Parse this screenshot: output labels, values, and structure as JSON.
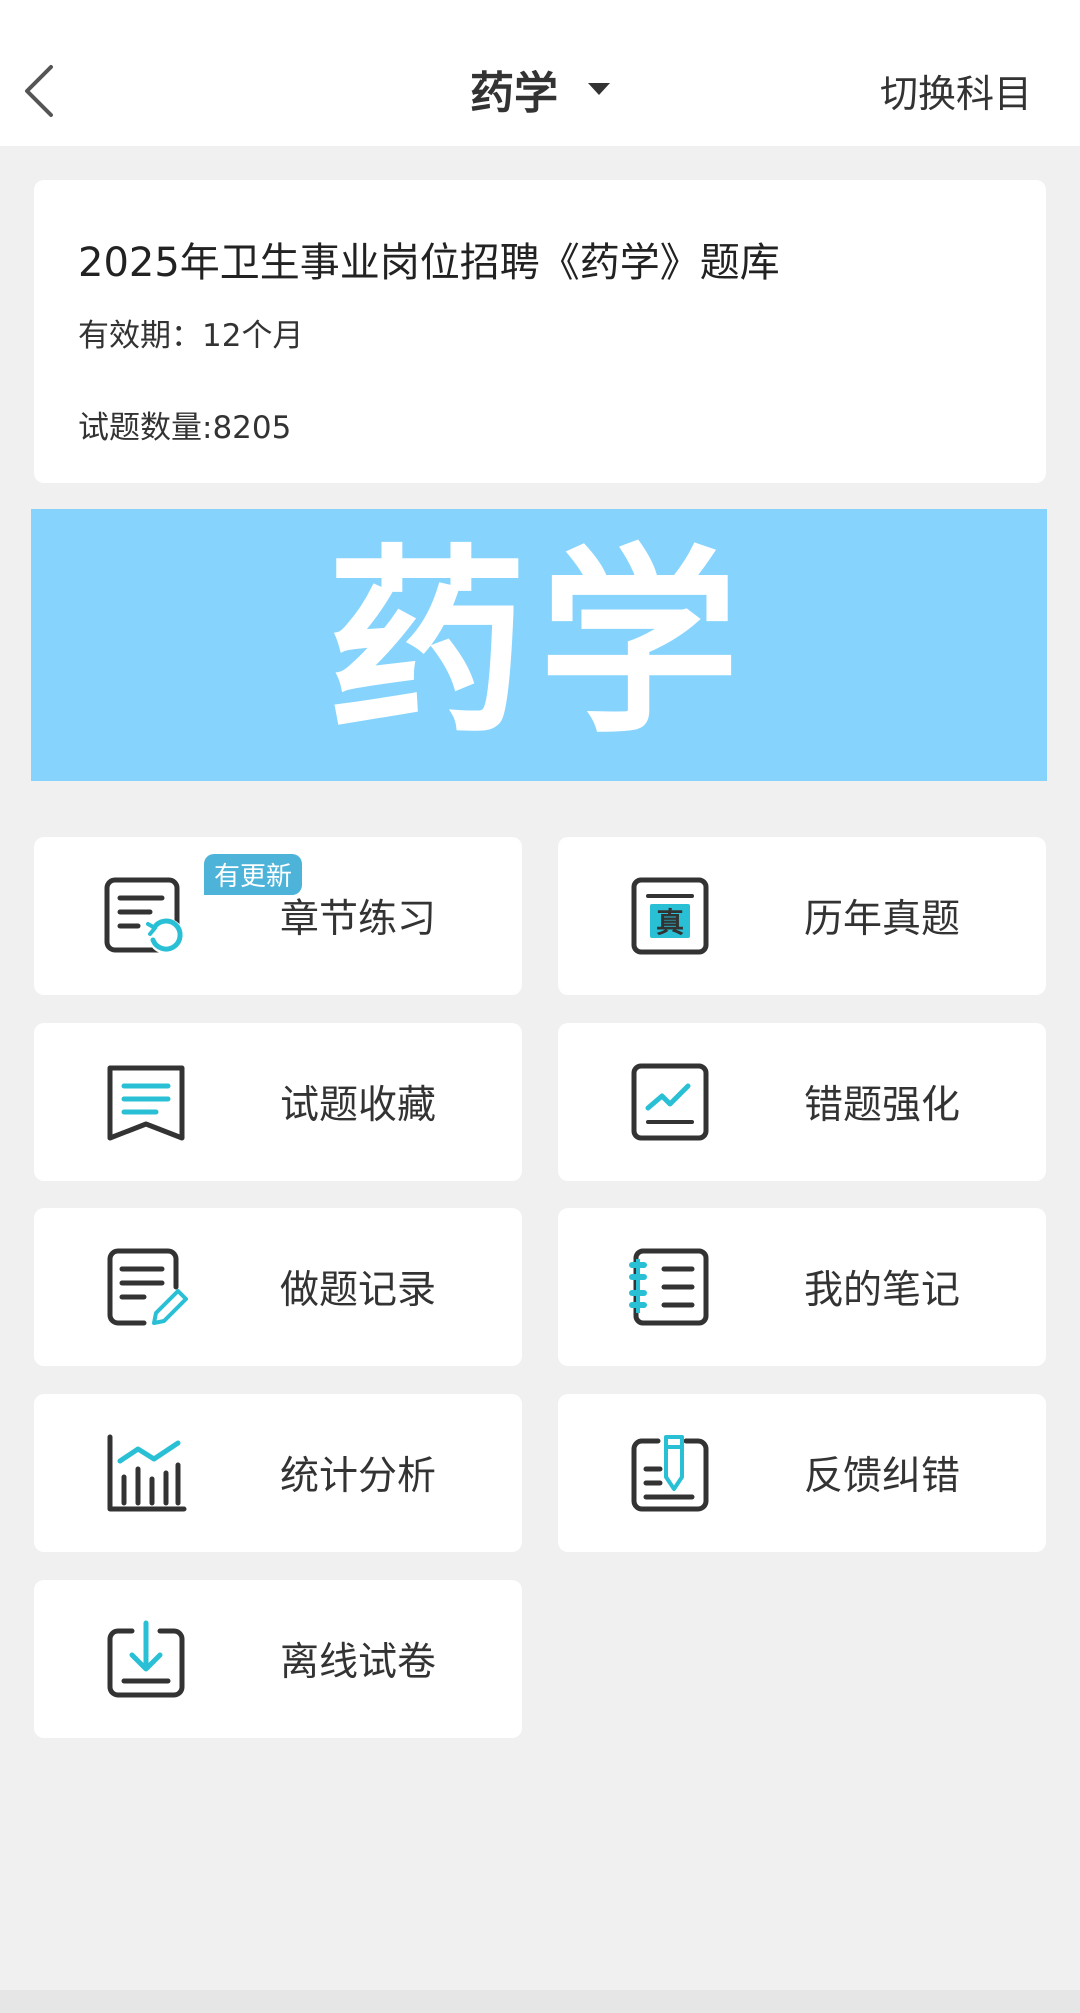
{
  "header": {
    "title": "药学",
    "switch_label": "切换科目"
  },
  "info": {
    "title": "2025年卫生事业岗位招聘《药学》题库",
    "validity": "有效期：12个月",
    "question_count": "试题数量:8205"
  },
  "banner": {
    "text": "药学"
  },
  "menu": [
    {
      "label": "章节练习",
      "icon": "chapter-refresh-icon",
      "badge": "有更新"
    },
    {
      "label": "历年真题",
      "icon": "real-exam-icon"
    },
    {
      "label": "试题收藏",
      "icon": "bookmark-icon"
    },
    {
      "label": "错题强化",
      "icon": "trend-chart-icon"
    },
    {
      "label": "做题记录",
      "icon": "edit-document-icon"
    },
    {
      "label": "我的笔记",
      "icon": "notebook-icon"
    },
    {
      "label": "统计分析",
      "icon": "bar-chart-icon"
    },
    {
      "label": "反馈纠错",
      "icon": "feedback-pen-icon"
    },
    {
      "label": "离线试卷",
      "icon": "download-icon"
    }
  ],
  "colors": {
    "accent": "#29c0d6",
    "icon_dark": "#333333",
    "banner_bg": "#86d4fd",
    "badge_bg": "#4db3d9"
  }
}
